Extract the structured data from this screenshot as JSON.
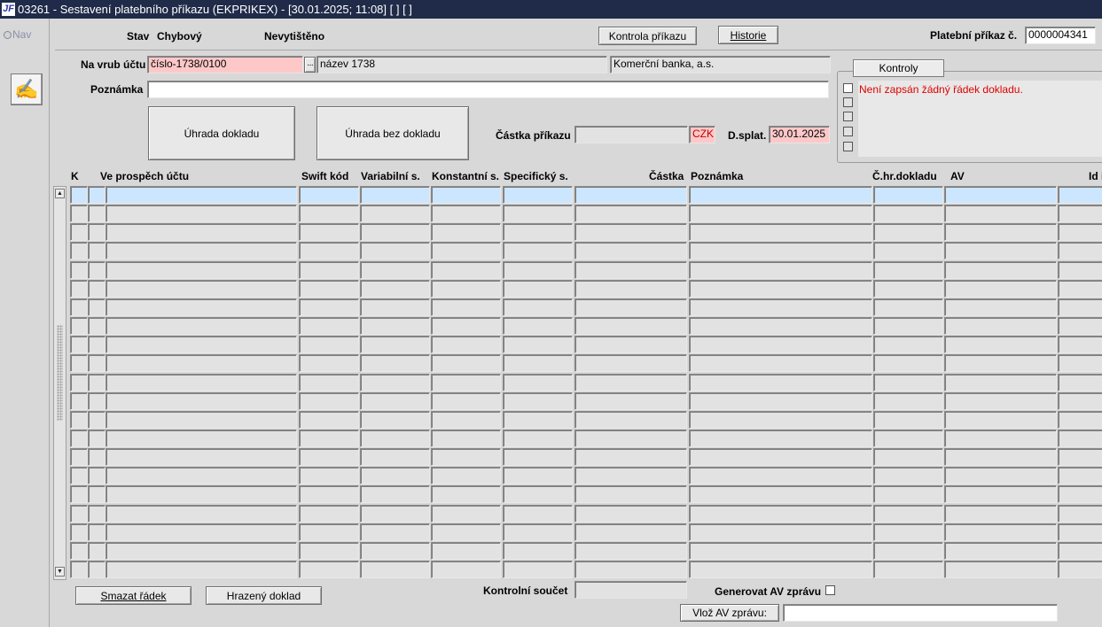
{
  "window": {
    "title": "03261 - Sestavení platebního příkazu (EKPRIKEX) - [30.01.2025; 11:08]  [ ]  [ ]",
    "icon": "app-logo-icon"
  },
  "nav": {
    "label": "Nav"
  },
  "toolbar": {
    "icon": "edit-document-icon"
  },
  "header": {
    "stav_label": "Stav",
    "stav_value": "Chybový",
    "print_state": "Nevytištěno",
    "kontrola_button": "Kontrola příkazu",
    "historie_button": "Historie",
    "prikaz_label": "Platební příkaz č.",
    "prikaz_value": "0000004341"
  },
  "form": {
    "vrub_label": "Na vrub účtu",
    "account_value": "číslo-1738/0100",
    "lookup_button": "···",
    "account_name": "název 1738",
    "bank_name": "Komerční banka, a.s.",
    "poznamka_label": "Poznámka",
    "poznamka_value": "",
    "uhrada_button": "Úhrada dokladu",
    "uhrada_bez_button": "Úhrada bez dokladu",
    "castka_label": "Částka příkazu",
    "castka_value": "",
    "currency": "CZK",
    "dsplat_label": "D.splat.",
    "dsplat_value": "30.01.2025"
  },
  "controls": {
    "tab_label": "Kontroly",
    "message": "Není zapsán žádný řádek dokladu."
  },
  "table": {
    "columns": [
      "K",
      "Ve prospěch účtu",
      "Swift kód",
      "Variabilní s.",
      "Konstantní s.",
      "Specifický s.",
      "Částka",
      "Poznámka",
      "Č.hr.dokladu",
      "AV",
      "Id i"
    ],
    "row_count": 21
  },
  "footer": {
    "smazat_button": "Smazat řádek",
    "hrazeny_button": "Hrazený doklad",
    "kontrolni_label": "Kontrolní součet",
    "kontrolni_value": "",
    "generovat_label": "Generovat AV zprávu",
    "vloz_button": "Vlož AV zprávu:",
    "vloz_value": ""
  },
  "colors": {
    "titlebar": "#1f2b48",
    "required": "#ffc8c8",
    "active_row": "#cce6ff",
    "error": "#e00000"
  }
}
